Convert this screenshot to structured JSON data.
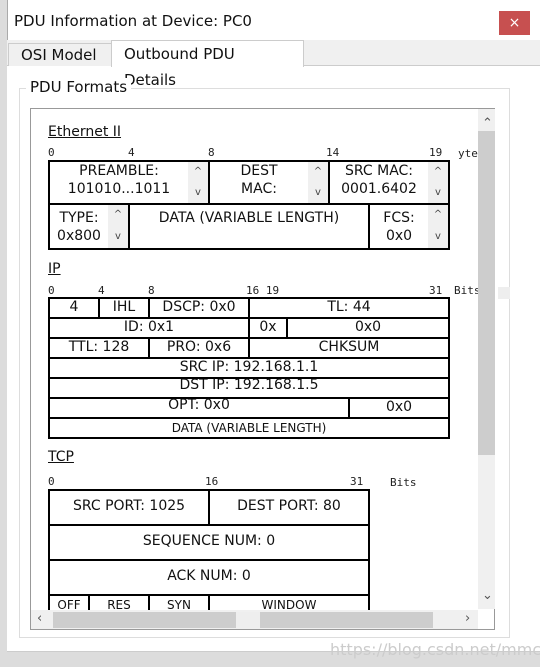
{
  "window": {
    "title": "PDU Information at Device: PC0",
    "close": "×"
  },
  "tabs": [
    {
      "label": "OSI Model"
    },
    {
      "label": "Outbound PDU Details"
    }
  ],
  "group_label": "PDU Formats",
  "ethernet": {
    "title": "Ethernet II",
    "ticks": [
      "0",
      "4",
      "8",
      "14",
      "19"
    ],
    "unit": "ytes",
    "preamble": [
      "PREAMBLE:",
      "101010...1011"
    ],
    "dest": [
      "DEST",
      "MAC:"
    ],
    "src": [
      "SRC MAC:",
      "0001.6402"
    ],
    "type": [
      "TYPE:",
      "0x800"
    ],
    "data": "DATA (VARIABLE LENGTH)",
    "fcs": [
      "FCS:",
      "0x0"
    ]
  },
  "ip": {
    "title": "IP",
    "ticks": [
      "0",
      "4",
      "8",
      "16 19",
      "31"
    ],
    "unit": "Bits",
    "cells": [
      "4",
      "IHL",
      "DSCP: 0x0",
      "TL: 44",
      "ID: 0x1",
      "0x",
      "0x0",
      "TTL: 128",
      "PRO: 0x6",
      "CHKSUM",
      "SRC IP: 192.168.1.1",
      "DST IP: 192.168.1.5",
      "OPT: 0x0",
      "0x0",
      "DATA (VARIABLE LENGTH)"
    ]
  },
  "tcp": {
    "title": "TCP",
    "ticks": [
      "0",
      "16",
      "31"
    ],
    "unit": "Bits",
    "cells": [
      "SRC PORT: 1025",
      "DEST PORT: 80",
      "SEQUENCE NUM: 0",
      "ACK NUM: 0",
      "OFF",
      "RES",
      "SYN",
      "WINDOW"
    ]
  },
  "spinner": {
    "up": "^",
    "down": "v"
  },
  "watermark": "https://blog.csdn.net/mmczjq"
}
